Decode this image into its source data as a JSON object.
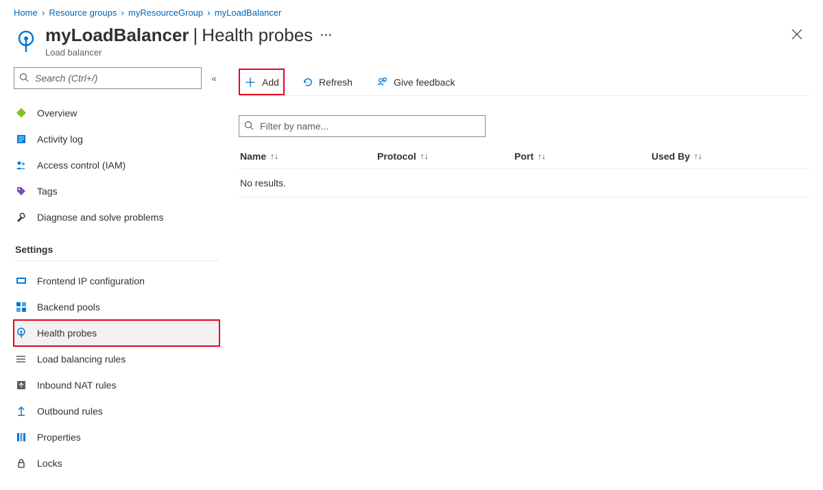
{
  "breadcrumbs": [
    "Home",
    "Resource groups",
    "myResourceGroup",
    "myLoadBalancer"
  ],
  "header": {
    "resource_name": "myLoadBalancer",
    "subpage": "Health probes",
    "subtitle": "Load balancer"
  },
  "sidebar": {
    "search_placeholder": "Search (Ctrl+/)",
    "nav_primary": [
      {
        "label": "Overview"
      },
      {
        "label": "Activity log"
      },
      {
        "label": "Access control (IAM)"
      },
      {
        "label": "Tags"
      },
      {
        "label": "Diagnose and solve problems"
      }
    ],
    "section_settings": "Settings",
    "nav_settings": [
      {
        "label": "Frontend IP configuration"
      },
      {
        "label": "Backend pools"
      },
      {
        "label": "Health probes",
        "selected": true
      },
      {
        "label": "Load balancing rules"
      },
      {
        "label": "Inbound NAT rules"
      },
      {
        "label": "Outbound rules"
      },
      {
        "label": "Properties"
      },
      {
        "label": "Locks"
      }
    ]
  },
  "toolbar": {
    "add": "Add",
    "refresh": "Refresh",
    "feedback": "Give feedback"
  },
  "table": {
    "filter_placeholder": "Filter by name...",
    "columns": [
      "Name",
      "Protocol",
      "Port",
      "Used By"
    ],
    "no_results": "No results."
  }
}
